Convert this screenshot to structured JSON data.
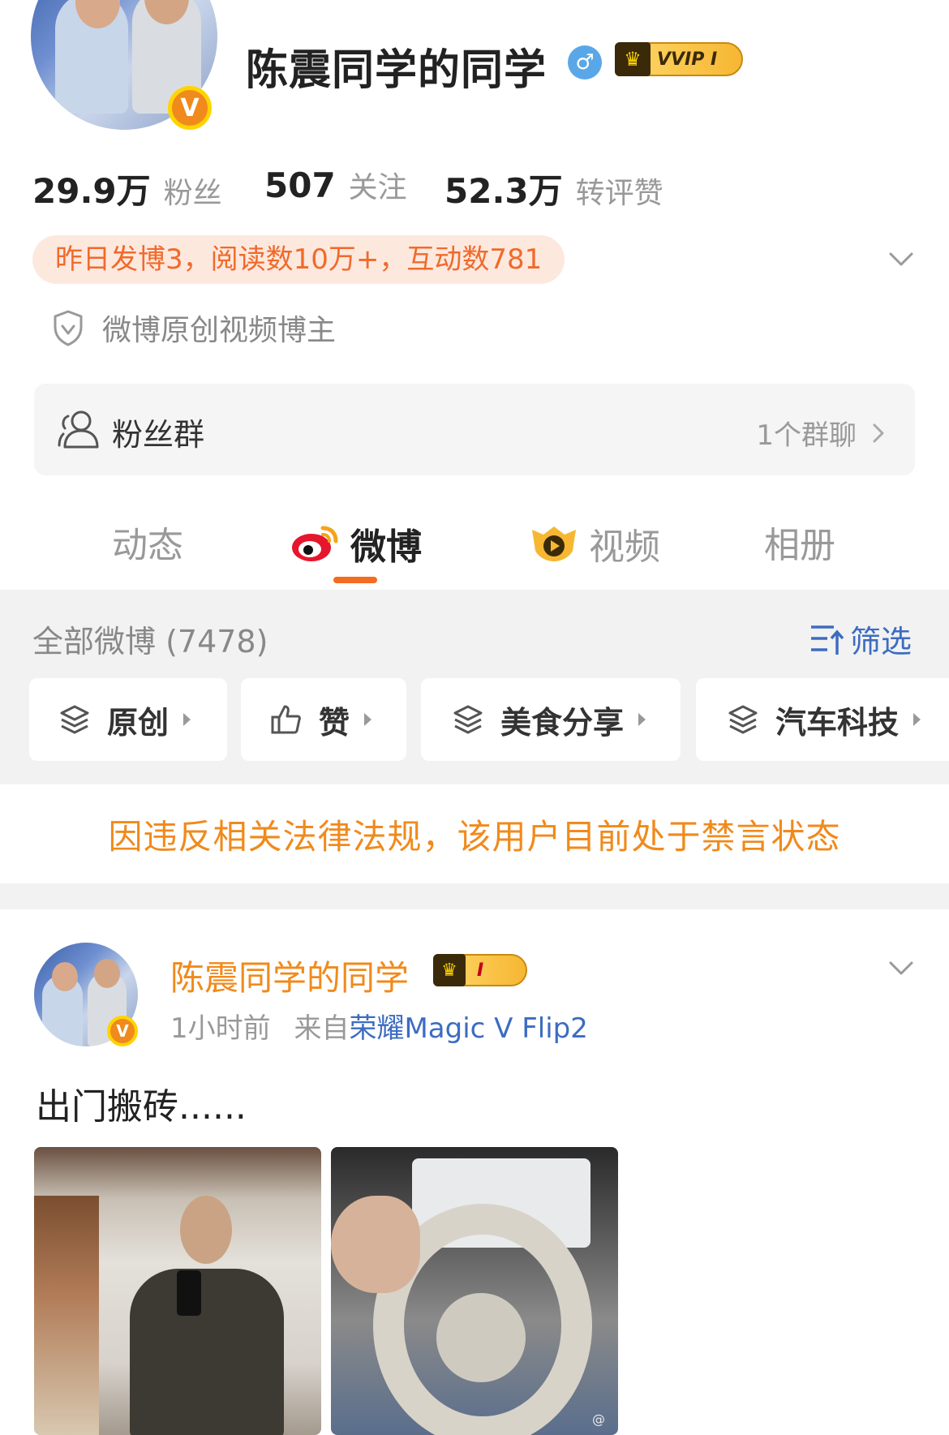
{
  "profile": {
    "name": "陈震同学的同学",
    "gender_symbol": "♂",
    "vip_crown": "♛",
    "vip_label": "VVIP I",
    "verified_symbol": "V",
    "stats": [
      {
        "value": "29.9万",
        "label": "粉丝"
      },
      {
        "value": "507",
        "label": "关注"
      },
      {
        "value": "52.3万",
        "label": "转评赞"
      }
    ],
    "activity": "昨日发博3，阅读数10万+，互动数781",
    "creator_label": "微博原创视频博主",
    "fan_group": {
      "label": "粉丝群",
      "count": "1个群聊"
    }
  },
  "tabs": [
    {
      "label": "动态",
      "active": false
    },
    {
      "label": "微博",
      "active": true
    },
    {
      "label": "视频",
      "active": false
    },
    {
      "label": "相册",
      "active": false
    }
  ],
  "feed": {
    "all_label": "全部微博 (7478)",
    "filter_label": "筛选",
    "chips": [
      "原创",
      "赞",
      "美食分享",
      "汽车科技"
    ]
  },
  "ban_notice": "因违反相关法律法规，该用户目前处于禁言状态",
  "post": {
    "author": "陈震同学的同学",
    "vip_crown": "♛",
    "vip_label": "I",
    "verified_symbol": "V",
    "time": "1小时前",
    "from_prefix": "来自",
    "source": "荣耀Magic V Flip2",
    "text": "出门搬砖......",
    "watermark": "@"
  },
  "colors": {
    "accent_orange": "#f36c21",
    "link_blue": "#3c6cc2",
    "activity_bg": "#fde8de"
  },
  "icons": [
    "gender-male-icon",
    "vip-crown-icon",
    "verified-v-icon",
    "chevron-down-icon",
    "shield-check-icon",
    "group-users-icon",
    "chevron-right-icon",
    "weibo-logo-icon",
    "video-play-icon",
    "filter-sort-icon",
    "layers-icon",
    "thumbs-up-icon"
  ]
}
